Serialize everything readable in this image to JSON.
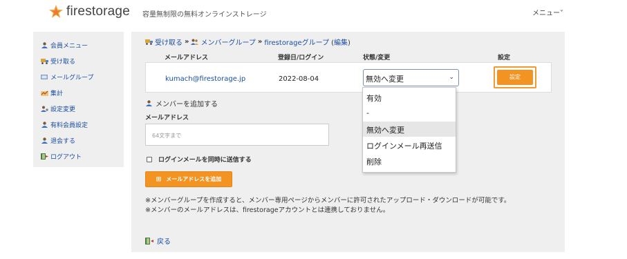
{
  "header": {
    "logo_text": "firestorage",
    "tagline": "容量無制限の無料オンラインストレージ",
    "menu_label": "メニュー˅"
  },
  "sidebar": {
    "items": [
      {
        "label": "会員メニュー",
        "icon": "person-icon"
      },
      {
        "label": "受け取る",
        "icon": "truck-icon"
      },
      {
        "label": "メールグループ",
        "icon": "mail-group-icon"
      },
      {
        "label": "集計",
        "icon": "chart-icon"
      },
      {
        "label": "設定変更",
        "icon": "settings-person-icon"
      },
      {
        "label": "有料会員設定",
        "icon": "person-icon"
      },
      {
        "label": "退会する",
        "icon": "person-exit-icon"
      },
      {
        "label": "ログアウト",
        "icon": "logout-icon"
      }
    ]
  },
  "breadcrumb": {
    "receive": "受け取る",
    "sep1": "»",
    "member_group": "メンバーグループ",
    "sep2": "»",
    "group_name": "firestorageグループ",
    "edit_open": "(",
    "edit": "編集",
    "edit_close": ")"
  },
  "table": {
    "headers": {
      "email": "メールアドレス",
      "date": "登録日/ログイン",
      "status": "状態/変更",
      "setting": "設定"
    },
    "rows": [
      {
        "email": "kumach@firestorage.jp",
        "date": "2022-08-04",
        "status_selected": "無効へ変更",
        "set_label": "設定"
      }
    ]
  },
  "status_dropdown": {
    "options": [
      "有効",
      "-",
      "無効へ変更",
      "ログインメール再送信",
      "削除"
    ],
    "selected_index": 2
  },
  "add_member": {
    "title": "メンバーを追加する",
    "email_label": "メールアドレス",
    "email_placeholder": "64文字まで",
    "send_login_checkbox": "ログインメールを同時に送信する",
    "add_button": "メールアドレスを追加",
    "add_button_icon": "⊞"
  },
  "notes": [
    "※メンバーグループを作成すると、メンバー専用ページからメンバーに許可されたアップロード・ダウンロードが可能です。",
    "※メンバーのメールアドレスは、firestorageアカウントとは連携しておりません。"
  ],
  "back_link": "戻る",
  "colors": {
    "link": "#1a4ea3",
    "accent_orange": "#f29322",
    "panel_bg": "#efefef"
  }
}
